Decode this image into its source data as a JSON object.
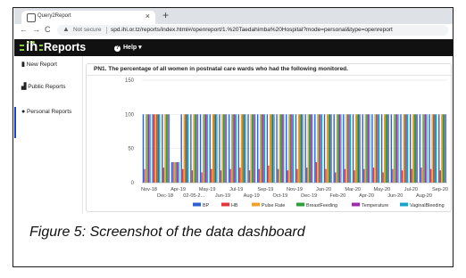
{
  "browser": {
    "tab_title": "Query2Report",
    "tab_close": "×",
    "new_tab": "+",
    "nav_back": "←",
    "nav_forward": "→",
    "nav_reload": "C",
    "security_label": "Not secure",
    "url": "spd.ihi.or.tz/reports/index.html#/openreport/1.%20Taedahimba%20Hospital?mode=personal&type=openreport"
  },
  "app": {
    "logo_letters": "ih",
    "logo_text": "Reports",
    "help_menu": "Help ▾"
  },
  "sidebar": {
    "items": [
      {
        "icon": "file-icon",
        "label": "New Report"
      },
      {
        "icon": "bar-chart-icon",
        "label": "Public Reports"
      },
      {
        "icon": "user-icon",
        "label": "Personal Reports",
        "active": true
      }
    ]
  },
  "report": {
    "title": "PN1. The percentage of all women in postnatal care wards who had the following monitored."
  },
  "chart_data": {
    "type": "bar",
    "ylim": [
      0,
      150
    ],
    "yticks": [
      0,
      50,
      100,
      150
    ],
    "x_labels_row1": [
      "Nov-18",
      "Apr-19",
      "May-19",
      "Jul-19",
      "Sep-19",
      "Nov-19",
      "Jan-20",
      "Mar-20",
      "May-20",
      "Jul-20",
      "Sep-20"
    ],
    "x_labels_row2": [
      "Dec-18",
      "02-05-2...",
      "Jun-19",
      "Aug-19",
      "Oct-19",
      "Dec-19",
      "Feb-20",
      "Apr-20",
      "Jun-20",
      "Aug-20"
    ],
    "series": [
      {
        "name": "BP",
        "color": "#2f5fd0"
      },
      {
        "name": "HB",
        "color": "#e0393e"
      },
      {
        "name": "Pulse Rate",
        "color": "#f0a030"
      },
      {
        "name": "BreastFeeding",
        "color": "#2e9e3e"
      },
      {
        "name": "Temperature",
        "color": "#9b2fa8"
      },
      {
        "name": "VaginalBleeding",
        "color": "#1aa3c8"
      }
    ],
    "period_values": [
      [
        100,
        20,
        100,
        100,
        100,
        100
      ],
      [
        100,
        100,
        100,
        100,
        100,
        100
      ],
      [
        100,
        22,
        100,
        100,
        100,
        100
      ],
      [
        30,
        30,
        30,
        30,
        30,
        30
      ],
      [
        100,
        20,
        100,
        100,
        100,
        100
      ],
      [
        100,
        18,
        100,
        100,
        100,
        100
      ],
      [
        100,
        15,
        100,
        100,
        100,
        100
      ],
      [
        100,
        20,
        100,
        100,
        100,
        100
      ],
      [
        100,
        18,
        100,
        100,
        100,
        100
      ],
      [
        100,
        20,
        100,
        100,
        100,
        100
      ],
      [
        100,
        22,
        100,
        100,
        100,
        100
      ],
      [
        100,
        18,
        100,
        100,
        100,
        100
      ],
      [
        100,
        20,
        100,
        100,
        100,
        100
      ],
      [
        100,
        25,
        100,
        100,
        100,
        100
      ],
      [
        100,
        20,
        100,
        100,
        100,
        100
      ],
      [
        100,
        18,
        100,
        100,
        100,
        100
      ],
      [
        100,
        20,
        100,
        100,
        100,
        100
      ],
      [
        100,
        22,
        100,
        100,
        100,
        100
      ],
      [
        100,
        30,
        100,
        100,
        100,
        100
      ],
      [
        100,
        20,
        100,
        100,
        100,
        100
      ],
      [
        100,
        15,
        100,
        100,
        100,
        100
      ],
      [
        100,
        20,
        100,
        100,
        100,
        100
      ],
      [
        100,
        18,
        100,
        100,
        100,
        100
      ],
      [
        100,
        20,
        100,
        100,
        100,
        100
      ],
      [
        100,
        22,
        100,
        100,
        100,
        100
      ],
      [
        100,
        15,
        100,
        100,
        100,
        100
      ],
      [
        100,
        20,
        100,
        100,
        100,
        100
      ],
      [
        100,
        18,
        100,
        100,
        100,
        100
      ],
      [
        100,
        20,
        100,
        100,
        100,
        100
      ],
      [
        100,
        22,
        100,
        100,
        100,
        100
      ],
      [
        100,
        20,
        100,
        100,
        100,
        100
      ],
      [
        100,
        18,
        100,
        100,
        100,
        100
      ]
    ]
  },
  "caption": "Figure 5: Screenshot of the data dashboard"
}
